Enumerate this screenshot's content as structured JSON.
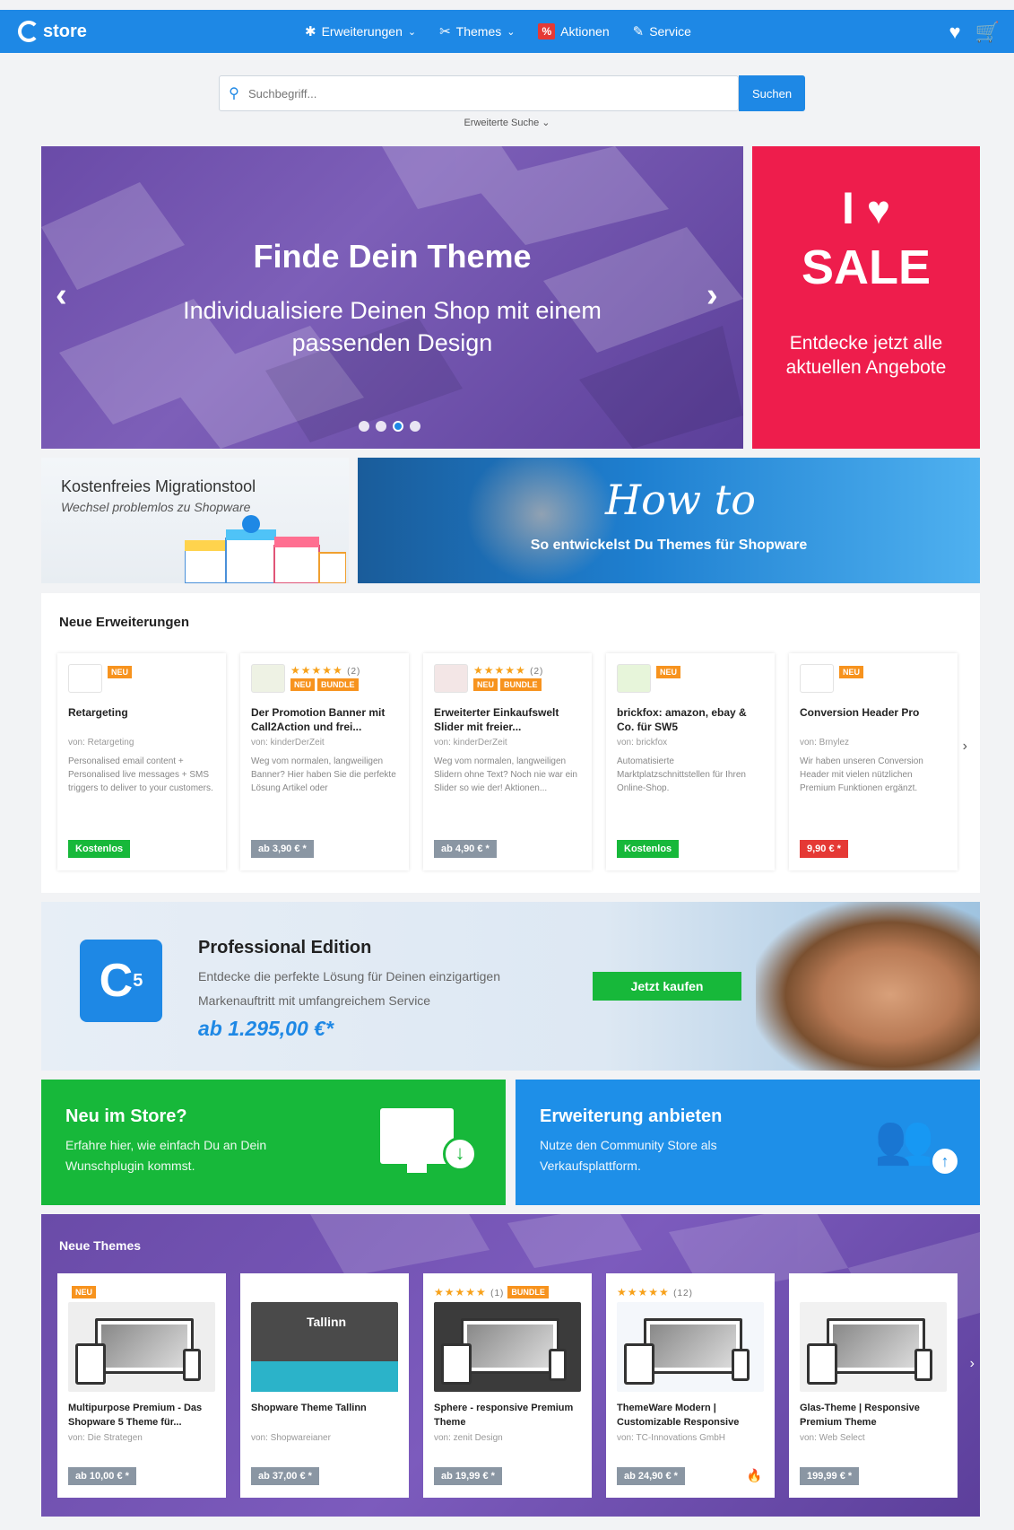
{
  "nav": {
    "logo_text": "store",
    "items": [
      {
        "label": "Erweiterungen",
        "icon": "puzzle-icon",
        "glyph": "✱",
        "chevron": "⌄"
      },
      {
        "label": "Themes",
        "icon": "brush-icon",
        "glyph": "✂",
        "chevron": "⌄"
      },
      {
        "label": "Aktionen",
        "icon": "percent-icon",
        "glyph": "%",
        "chevron": ""
      },
      {
        "label": "Service",
        "icon": "wrench-icon",
        "glyph": "✎",
        "chevron": ""
      }
    ],
    "heart_glyph": "♥",
    "cart_glyph": "🛒"
  },
  "search": {
    "placeholder": "Suchbegriff...",
    "button_label": "Suchen",
    "advanced_label": "Erweiterte Suche ⌄",
    "icon_glyph": "⚲"
  },
  "hero": {
    "title": "Finde Dein Theme",
    "subtitle": "Individualisiere Deinen Shop mit einem passenden Design",
    "prev_glyph": "‹",
    "next_glyph": "›",
    "active_slide": 3
  },
  "sale": {
    "line1": "I",
    "heart": "♥",
    "word": "SALE",
    "text": "Entdecke jetzt alle aktuellen Angebote"
  },
  "migration": {
    "title": "Kostenfreies Migrationstool",
    "subtitle": "Wechsel problemlos zu Shopware"
  },
  "howto": {
    "title": "How to",
    "subtitle": "So entwickelst Du Themes für Shopware"
  },
  "extensions": {
    "heading": "Neue Erweiterungen",
    "next_glyph": "›",
    "items": [
      {
        "name": "Retargeting",
        "vendor": "von: Retargeting",
        "desc": "Personalised email content + Personalised live messages + SMS triggers to deliver to your customers.",
        "price": "Kostenlos",
        "price_style": "green",
        "stars": "",
        "star_count": "",
        "badges": [
          "NEU"
        ],
        "logo_color": "#ffffff"
      },
      {
        "name": "Der Promotion Banner mit Call2Action und frei...",
        "vendor": "von: kinderDerZeit",
        "desc": "Weg vom normalen, langweiligen Banner? Hier haben Sie die perfekte Lösung Artikel oder",
        "price": "ab 3,90 € *",
        "price_style": "gray",
        "stars": "★★★★★",
        "star_count": "(2)",
        "badges": [
          "NEU",
          "BUNDLE"
        ],
        "logo_color": "#eef2e4"
      },
      {
        "name": "Erweiterter Einkaufswelt Slider mit freier...",
        "vendor": "von: kinderDerZeit",
        "desc": "Weg vom normalen, langweiligen Slidern ohne Text? Noch nie war ein Slider so wie der! Aktionen...",
        "price": "ab 4,90 € *",
        "price_style": "gray",
        "stars": "★★★★★",
        "star_count": "(2)",
        "badges": [
          "NEU",
          "BUNDLE"
        ],
        "logo_color": "#f3e6e6"
      },
      {
        "name": "brickfox: amazon, ebay & Co. für SW5",
        "vendor": "von: brickfox",
        "desc": "Automatisierte Marktplatzschnittstellen für Ihren Online-Shop.",
        "price": "Kostenlos",
        "price_style": "green",
        "stars": "",
        "star_count": "",
        "badges": [
          "NEU"
        ],
        "logo_color": "#e7f5da"
      },
      {
        "name": "Conversion Header Pro",
        "vendor": "von: Brnylez",
        "desc": "Wir haben unseren Conversion Header mit vielen nützlichen Premium Funktionen ergänzt.",
        "price": "9,90 € *",
        "price_style": "red",
        "stars": "",
        "star_count": "",
        "badges": [
          "NEU"
        ],
        "logo_color": "#ffffff"
      }
    ]
  },
  "pro": {
    "title": "Professional Edition",
    "text": "Entdecke die perfekte Lösung für Deinen einzigartigen Markenauftritt mit umfangreichem Service",
    "price": "ab 1.295,00 €*",
    "button_label": "Jetzt kaufen",
    "logo_glyph": "C",
    "logo_sub": "5"
  },
  "tiles": {
    "new": {
      "title": "Neu im Store?",
      "text": "Erfahre hier, wie einfach Du an Dein Wunschplugin kommst.",
      "glyph": "↓"
    },
    "offer": {
      "title": "Erweiterung anbieten",
      "text": "Nutze den Community Store als Verkaufsplattform.",
      "glyph": "↑",
      "people_glyph": "👥"
    }
  },
  "themes": {
    "heading": "Neue Themes",
    "next_glyph": "›",
    "items": [
      {
        "name": "Multipurpose Premium - Das Shopware 5 Theme für...",
        "vendor": "von: Die Strategen",
        "price": "ab 10,00 € *",
        "stars": "",
        "star_count": "",
        "badges": [
          "NEU"
        ],
        "img_bg": "#eeeeee",
        "img_label": ""
      },
      {
        "name": "Shopware Theme Tallinn",
        "vendor": "von: Shopwareianer",
        "price": "ab 37,00 € *",
        "stars": "",
        "star_count": "",
        "badges": [],
        "img_bg": "#4a4a4a",
        "img_label": "Tallinn"
      },
      {
        "name": "Sphere - responsive Premium Theme",
        "vendor": "von: zenit Design",
        "price": "ab 19,99 € *",
        "stars": "★★★★★",
        "star_count": "(1)",
        "badges": [
          "BUNDLE"
        ],
        "img_bg": "#3b3b3b",
        "img_label": ""
      },
      {
        "name": "ThemeWare Modern | Customizable Responsive",
        "vendor": "von: TC-Innovations GmbH",
        "price": "ab 24,90 € *",
        "stars": "★★★★★",
        "star_count": "(12)",
        "badges": [],
        "img_bg": "#f4f7fb",
        "img_label": ""
      },
      {
        "name": "Glas-Theme | Responsive Premium Theme",
        "vendor": "von: Web Select",
        "price": "199,99 € *",
        "stars": "",
        "star_count": "",
        "badges": [],
        "img_bg": "#f1f1f1",
        "img_label": ""
      }
    ],
    "fire_glyph": "🔥"
  },
  "colors": {
    "brand_blue": "#1e88e5",
    "green": "#17b83a",
    "sale_red": "#ee1d4c",
    "purple": "#6a4ba8",
    "badge_orange": "#f7931e"
  }
}
